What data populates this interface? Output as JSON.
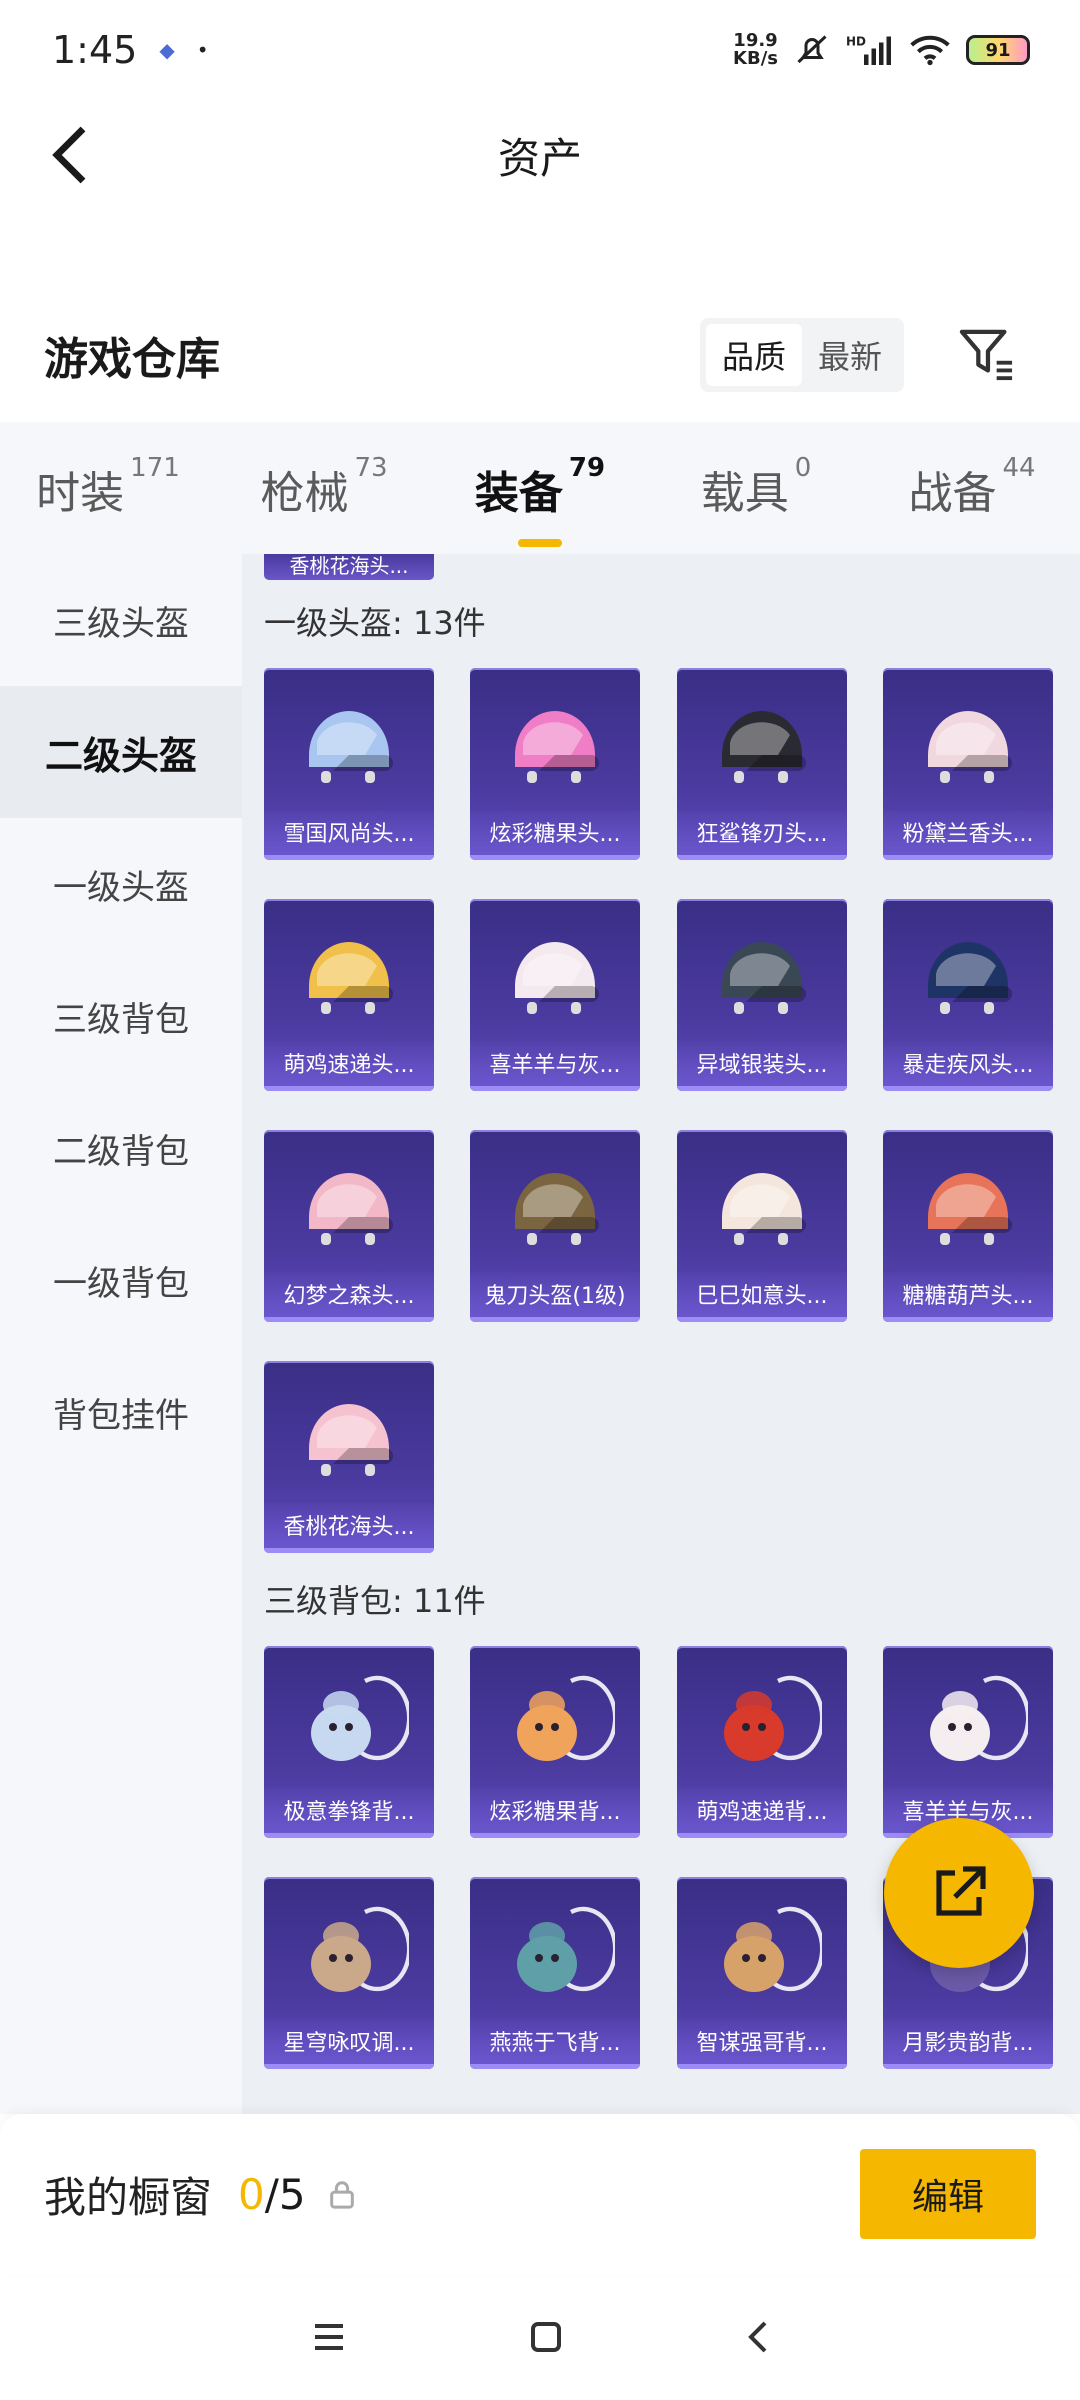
{
  "status_bar": {
    "time": "1:45",
    "net_speed_top": "19.9",
    "net_speed_bottom": "KB/s",
    "battery": "91"
  },
  "header": {
    "title": "资产"
  },
  "warehouse": {
    "title": "游戏仓库",
    "sort_options": [
      "品质",
      "最新"
    ],
    "active_sort": "品质"
  },
  "tabs": [
    {
      "label": "时装",
      "count": "171"
    },
    {
      "label": "枪械",
      "count": "73"
    },
    {
      "label": "装备",
      "count": "79",
      "active": true
    },
    {
      "label": "载具",
      "count": "0"
    },
    {
      "label": "战备",
      "count": "44"
    }
  ],
  "sidebar": [
    {
      "label": "三级头盔"
    },
    {
      "label": "二级头盔",
      "active": true
    },
    {
      "label": "一级头盔"
    },
    {
      "label": "三级背包"
    },
    {
      "label": "二级背包"
    },
    {
      "label": "一级背包"
    },
    {
      "label": "背包挂件"
    }
  ],
  "content": {
    "top_partial_label": "香桃花海头...",
    "sections": [
      {
        "header": "一级头盔: 13件",
        "items": [
          {
            "label": "雪国风尚头...",
            "icon": "helmet-blue-icon",
            "color": "#a9c6f0"
          },
          {
            "label": "炫彩糖果头...",
            "icon": "helmet-pink-icon",
            "color": "#f07ec6"
          },
          {
            "label": "狂鲨锋刃头...",
            "icon": "helmet-black-icon",
            "color": "#2a2a32"
          },
          {
            "label": "粉黛兰香头...",
            "icon": "helmet-white-icon",
            "color": "#f1d8df"
          },
          {
            "label": "萌鸡速递头...",
            "icon": "helmet-yellow-icon",
            "color": "#f1c04a"
          },
          {
            "label": "喜羊羊与灰...",
            "icon": "helmet-sheep-icon",
            "color": "#f4e9ef"
          },
          {
            "label": "异域银装头...",
            "icon": "helmet-silver-icon",
            "color": "#3a4856"
          },
          {
            "label": "暴走疾风头...",
            "icon": "helmet-navy-icon",
            "color": "#1f3466"
          },
          {
            "label": "幻梦之森头...",
            "icon": "helmet-fairy-icon",
            "color": "#f2b8c8"
          },
          {
            "label": "鬼刀头盔(1级)",
            "icon": "helmet-gold-icon",
            "color": "#7b6440"
          },
          {
            "label": "巳巳如意头...",
            "icon": "helmet-cream-icon",
            "color": "#f4e6dc"
          },
          {
            "label": "糖糖葫芦头...",
            "icon": "helmet-red-icon",
            "color": "#e77458"
          },
          {
            "label": "香桃花海头...",
            "icon": "helmet-peach-icon",
            "color": "#f5c2cf"
          }
        ]
      },
      {
        "header": "三级背包: 11件",
        "items": [
          {
            "label": "极意拳锋背...",
            "icon": "backpack-elephant-icon",
            "color": "#c7d9f0"
          },
          {
            "label": "炫彩糖果背...",
            "icon": "backpack-donut-icon",
            "color": "#f0a35a"
          },
          {
            "label": "萌鸡速递背...",
            "icon": "backpack-chicken-icon",
            "color": "#d83a2b"
          },
          {
            "label": "喜羊羊与灰...",
            "icon": "backpack-sheep-icon",
            "color": "#f4eef0"
          },
          {
            "label": "星穹咏叹调...",
            "icon": "backpack-ornate-icon",
            "color": "#c9a989"
          },
          {
            "label": "燕燕于飞背...",
            "icon": "backpack-tech-icon",
            "color": "#5fa0a8"
          },
          {
            "label": "智谋强哥背...",
            "icon": "backpack-bear-icon",
            "color": "#d7a26a"
          },
          {
            "label": "月影贵韵背...",
            "icon": "backpack-moon-icon",
            "color": "#6b5aa8"
          }
        ]
      }
    ]
  },
  "bottom_panel": {
    "title": "我的橱窗",
    "count_current": "0",
    "count_total": "/5",
    "edit_label": "编辑"
  }
}
